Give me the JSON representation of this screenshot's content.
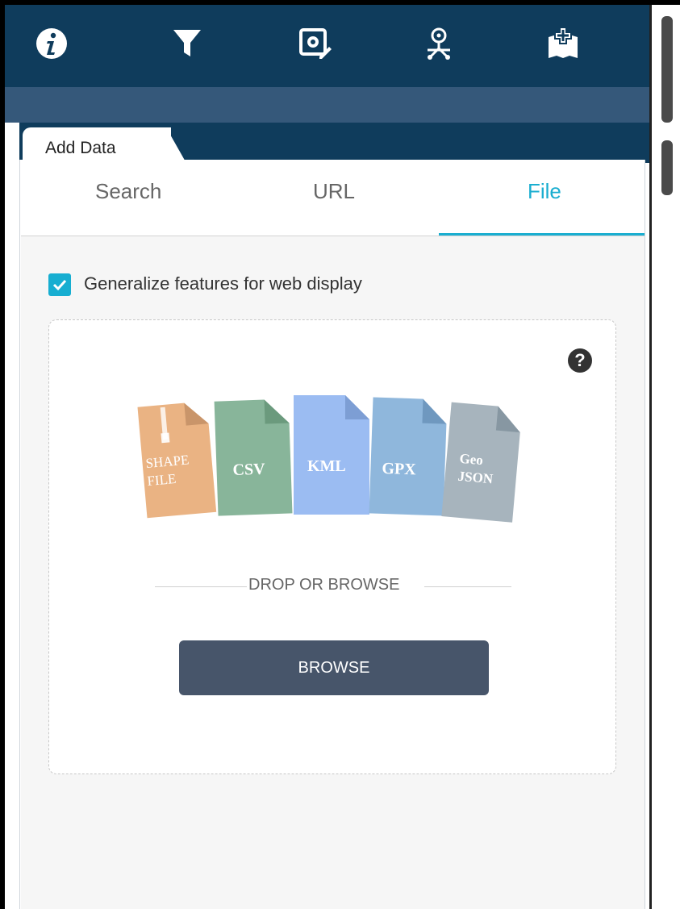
{
  "toolbar": {
    "buttons": [
      {
        "icon": "info-icon"
      },
      {
        "icon": "filter-icon"
      },
      {
        "icon": "settings-edit-icon"
      },
      {
        "icon": "location-network-icon"
      },
      {
        "icon": "add-data-map-icon"
      }
    ]
  },
  "panel": {
    "title": "Add Data",
    "tabs": [
      {
        "label": "Search",
        "active": false
      },
      {
        "label": "URL",
        "active": false
      },
      {
        "label": "File",
        "active": true
      }
    ]
  },
  "file_tab": {
    "generalize_label": "Generalize features for web display",
    "generalize_checked": true,
    "help": "?",
    "file_types": [
      {
        "label": "SHAPE FILE",
        "color": "#eab383"
      },
      {
        "label": "CSV",
        "color": "#88b59a"
      },
      {
        "label": "KML",
        "color": "#9bbcf2"
      },
      {
        "label": "GPX",
        "color": "#8fb7dc"
      },
      {
        "label": "Geo JSON",
        "color": "#a7b4bd"
      }
    ],
    "divider_text": "DROP OR BROWSE",
    "browse_label": "BROWSE"
  },
  "colors": {
    "toolbar_bg": "#0f3c5c",
    "toolbar_strip": "#35587a",
    "accent": "#1aaed0",
    "button_bg": "#47556a"
  }
}
